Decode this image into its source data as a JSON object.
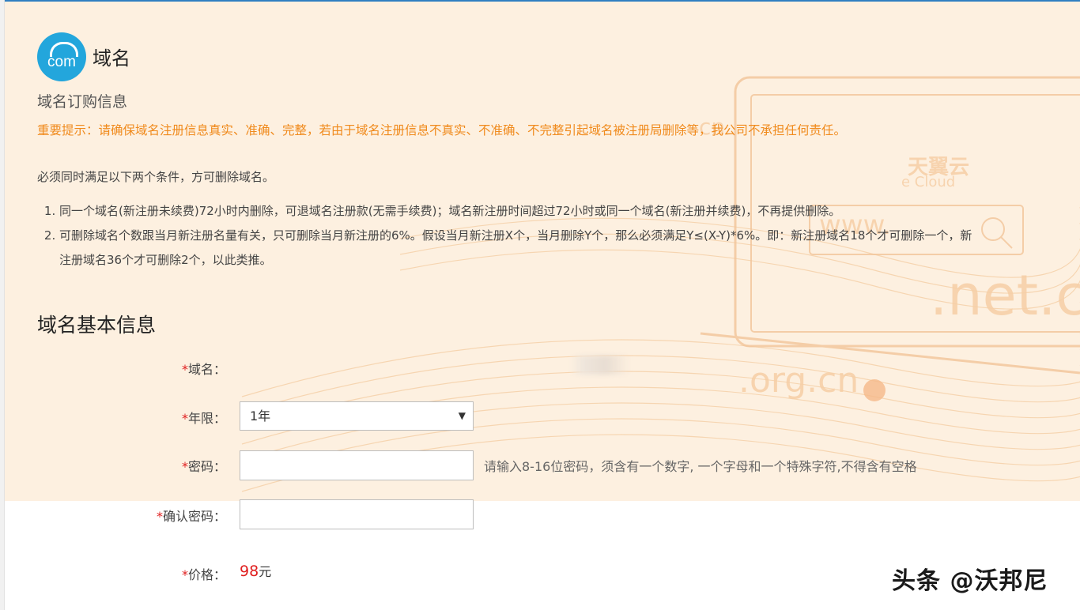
{
  "app": {
    "logo_text": "com",
    "title": "域名"
  },
  "order_info": {
    "heading": "域名订购信息",
    "notice": "重要提示：请确保域名注册信息真实、准确、完整，若由于域名注册信息不真实、不准确、不完整引起域名被注册局删除等，我公司不承担任何责任。",
    "conditions_intro": "必须同时满足以下两个条件，方可删除域名。",
    "rules": [
      "同一个域名(新注册未续费)72小时内删除，可退域名注册款(无需手续费)；域名新注册时间超过72小时或同一个域名(新注册并续费)，不再提供删除。",
      "可删除域名个数跟当月新注册名量有关，只可删除当月新注册的6%。假设当月新注册X个，当月删除Y个，那么必须满足Y≤(X-Y)*6%。即：新注册域名18个才可删除一个，新注册域名36个才可删除2个，以此类推。"
    ]
  },
  "banner": {
    "brand_cn": "天翼云",
    "brand_en": "e Cloud",
    "www": "www.",
    "net": ".net.c",
    "org": ".org.cn",
    "cn": "cn"
  },
  "basic_info": {
    "heading": "域名基本信息",
    "required_mark": "*",
    "domain_label": "域名：",
    "term_label": "年限：",
    "term_value": "1年",
    "password_label": "密码：",
    "password_value": "",
    "password_hint": "请输入8-16位密码，须含有一个数字, 一个字母和一个特殊字符,不得含有空格",
    "confirm_label": "确认密码：",
    "confirm_value": "",
    "price_label": "价格：",
    "price_value": "98",
    "price_unit": "元"
  },
  "watermark": "头条 @沃邦尼",
  "colors": {
    "notice": "#f08a1c",
    "required": "#e02020",
    "logo": "#23a6dc",
    "banner_bg": "#fdf0e0"
  }
}
